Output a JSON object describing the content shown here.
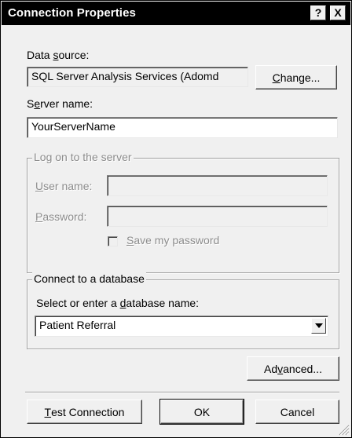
{
  "window": {
    "title": "Connection Properties",
    "help_button": "?",
    "close_button": "X"
  },
  "data_source": {
    "label_pre": "Data ",
    "label_u": "s",
    "label_post": "ource:",
    "value": "SQL Server Analysis Services (Adomd",
    "change_pre": "",
    "change_u": "C",
    "change_post": "hange..."
  },
  "server_name": {
    "label_pre": "S",
    "label_u": "e",
    "label_post": "rver name:",
    "value": "YourServerName"
  },
  "logon_group": {
    "title": "Log on to the server",
    "user_name_pre": "",
    "user_name_u": "U",
    "user_name_post": "ser name:",
    "user_name_value": "",
    "password_pre": "",
    "password_u": "P",
    "password_post": "assword:",
    "password_value": "",
    "save_password_pre": "",
    "save_password_u": "S",
    "save_password_post": "ave my password"
  },
  "database_group": {
    "title": "Connect to a database",
    "select_label_pre": "Select or enter a ",
    "select_label_u": "d",
    "select_label_post": "atabase name:",
    "selected_value": "Patient Referral"
  },
  "buttons": {
    "advanced_pre": "Ad",
    "advanced_u": "v",
    "advanced_post": "anced...",
    "test_pre": "",
    "test_u": "T",
    "test_post": "est Connection",
    "ok": "OK",
    "cancel": "Cancel"
  }
}
